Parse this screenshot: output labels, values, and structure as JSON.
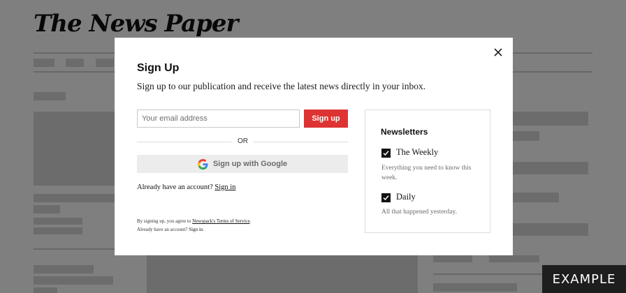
{
  "background": {
    "logo": "The News Paper"
  },
  "modal": {
    "title": "Sign Up",
    "subtitle": "Sign up to our publication and receive the latest news directly in your inbox.",
    "email_placeholder": "Your email address",
    "signup_label": "Sign up",
    "or_label": "OR",
    "google_label": "Sign up with Google",
    "already_text": "Already have an account?",
    "signin_link": "Sign in",
    "terms_prefix": "By signing up, you agree to",
    "terms_link": "Newspack's Terms of Service",
    "terms_suffix": ".",
    "terms_line2_prefix": "Already have an account?",
    "terms_line2_link": "Sign in",
    "terms_line2_suffix": "."
  },
  "newsletters": {
    "heading": "Newsletters",
    "items": [
      {
        "name": "The Weekly",
        "description": "Everything you need to know this week.",
        "checked": true
      },
      {
        "name": "Daily",
        "description": "All that happened yesterday.",
        "checked": true
      }
    ]
  },
  "badge": "EXAMPLE",
  "colors": {
    "accent": "#dd3333",
    "scrim": "#000000"
  },
  "icons": {
    "close": "close-icon",
    "google": "google-icon",
    "check": "checkmark-icon"
  }
}
